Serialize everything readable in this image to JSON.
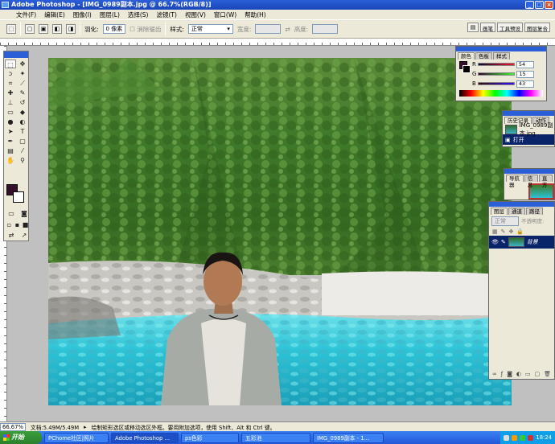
{
  "window": {
    "title": "Adobe Photoshop - [IMG_0989副本.jpg @ 66.7%(RGB/8)]"
  },
  "menu": [
    "文件(F)",
    "编辑(E)",
    "图像(I)",
    "图层(L)",
    "选择(S)",
    "滤镜(T)",
    "视图(V)",
    "窗口(W)",
    "帮助(H)"
  ],
  "options": {
    "feather_label": "羽化:",
    "feather_value": "0 像素",
    "antialias_label": "消除锯齿",
    "style_label": "样式:",
    "style_value": "正常",
    "width_label": "宽度:",
    "height_label": "高度:"
  },
  "palette_well": [
    "画笔",
    "工具预设",
    "图层复合"
  ],
  "color_panel": {
    "tabs": [
      "颜色",
      "色板",
      "样式"
    ],
    "channels": [
      {
        "label": "R",
        "value": "54"
      },
      {
        "label": "G",
        "value": "15"
      },
      {
        "label": "B",
        "value": "43"
      }
    ],
    "foreground": "#36102b"
  },
  "history_panel": {
    "tabs": [
      "历史记录",
      "动作"
    ],
    "items": [
      "IMG_0989副本.jpg",
      "打开"
    ]
  },
  "navigator_panel": {
    "tabs": [
      "导航器",
      "信息",
      "直方"
    ]
  },
  "layers_panel": {
    "tabs": [
      "图层",
      "通道",
      "路径"
    ],
    "blend_mode": "正常",
    "opacity_label": "不透明度:",
    "layer_name": "背景"
  },
  "status": {
    "zoom": "66.67%",
    "doc": "文档:5.49M/5.49M",
    "hint": "绘制矩形选区或移动选区外框。要用附加选项，使用 Shift、Alt 和 Ctrl 键。"
  },
  "taskbar": {
    "start": "开始",
    "items": [
      "PChome社区|照片",
      "Adobe Photoshop ...",
      "ps色彩",
      "五彩池",
      "IMG_0989副本 - 1..."
    ],
    "time": "18:24"
  }
}
